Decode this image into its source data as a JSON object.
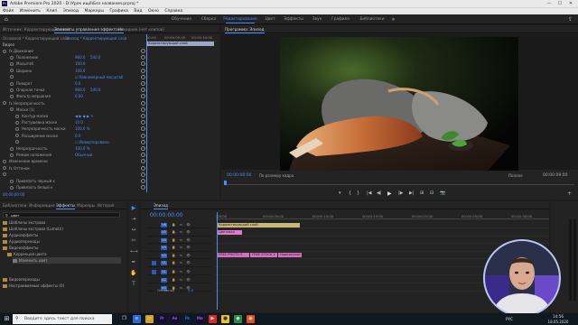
{
  "window": {
    "title": "Adobe Premiere Pro 2020 - D:\\Урок ищё\\Без названия.prproj *",
    "logo": "Pr",
    "min": "—",
    "max": "☐",
    "close": "✕"
  },
  "menu": [
    "Файл",
    "Изменить",
    "Клип",
    "Эпизод",
    "Маркеры",
    "Графика",
    "Вид",
    "Окно",
    "Справка"
  ],
  "workspaces": [
    "Обучение",
    "Сборка",
    "Редактирование",
    "Цвет",
    "Эффекты",
    "Звук",
    "Графика",
    "Библиотеки"
  ],
  "workspace_active": "Редактирование",
  "top_icons": {
    "home": "⌂",
    "more": "»",
    "export": "⇪"
  },
  "effect_controls": {
    "tabs": [
      {
        "label": "Источник: Корректирующий слой",
        "active": false
      },
      {
        "label": "Элементы управления эффектами",
        "active": true
      },
      {
        "label": "Исходник (нет клипов)",
        "active": false
      }
    ],
    "header_source": "Основной * Корректирующий слой",
    "header_seq": "Эпизод * Корректирующий слой",
    "clip_label": "Корректирующий слой",
    "timecodes": [
      "00:00",
      "00:00:05:00",
      "00:00:10:00"
    ],
    "section_video": "Видео",
    "rows": [
      {
        "label": "fx Движение",
        "v1": "",
        "v2": ""
      },
      {
        "label": "Положение",
        "v1": "960.0",
        "v2": "540.0"
      },
      {
        "label": "Масштаб",
        "v1": "100.0",
        "v2": ""
      },
      {
        "label": "Ширина",
        "v1": "100.0",
        "v2": ""
      },
      {
        "label": "",
        "v1": "☑ Равномерный масштаб",
        "v2": ""
      },
      {
        "label": "Поворот",
        "v1": "0.0",
        "v2": ""
      },
      {
        "label": "Опорная точка",
        "v1": "960.0",
        "v2": "540.0"
      },
      {
        "label": "Фильтр мерцания",
        "v1": "0.00",
        "v2": ""
      },
      {
        "label": "fx Непрозрачность",
        "v1": "",
        "v2": ""
      },
      {
        "label": "Маски (1)",
        "v1": "",
        "v2": ""
      },
      {
        "label": "Контур маски",
        "v1": "◀ ▶ ◆ ▶ ✎",
        "v2": ""
      },
      {
        "label": "Растушевка маски",
        "v1": "10.0",
        "v2": ""
      },
      {
        "label": "Непрозрачность маски",
        "v1": "100.0 %",
        "v2": ""
      },
      {
        "label": "Расширение маски",
        "v1": "0.0",
        "v2": ""
      },
      {
        "label": "",
        "v1": "☐ Инвертировано",
        "v2": ""
      },
      {
        "label": "Непрозрачность",
        "v1": "100.0 %",
        "v2": ""
      },
      {
        "label": "Режим наложения",
        "v1": "Обычный",
        "v2": ""
      },
      {
        "label": "Изменение времени",
        "v1": "",
        "v2": ""
      },
      {
        "label": "fx Оттенок",
        "v1": "",
        "v2": ""
      },
      {
        "label": "",
        "v1": "",
        "v2": ""
      },
      {
        "label": "Привязать черный к",
        "v1": "",
        "v2": ""
      },
      {
        "label": "Привязать белый к",
        "v1": "",
        "v2": ""
      }
    ],
    "footer_time": "00:00:00:00"
  },
  "program": {
    "tab": "Программа: Эпизод",
    "timecode": "00:00:00:00",
    "fit": "По размеру кадра",
    "quality": "Полное",
    "duration": "00:00:09:00",
    "transport": [
      "▾",
      "{",
      "}",
      "|◀",
      "◀|",
      "▶",
      "|▶",
      "▶|",
      "⊞",
      "⊟",
      "📷",
      "+"
    ]
  },
  "project": {
    "tabs": [
      {
        "label": "Библиотеки",
        "active": false
      },
      {
        "label": "Информация",
        "active": false
      },
      {
        "label": "Эффекты",
        "active": true
      },
      {
        "label": "Маркеры",
        "active": false
      },
      {
        "label": "История",
        "active": false
      }
    ],
    "search_value": "цвет",
    "items": [
      "Шаблоны экстрава",
      "Шаблоны экстрава (Lumetri)",
      "Аудиоэффекты",
      "Аудиопереходы",
      "Видеоэффекты",
      "Коррекция цвета",
      "Изменить цвет",
      "Видеопереходы",
      "Настраиваемые эффекты (0)"
    ]
  },
  "timeline": {
    "tab": "Эпизод",
    "timecode": "00:00:00:00",
    "ruler": [
      ":00:00",
      "00:00:05:00",
      "00:00:10:00",
      "00:00:15:00",
      "00:00:20:00",
      "00:00:25:00",
      "00:00:30:00"
    ],
    "tracks": [
      {
        "name": "V6",
        "label": "",
        "sel": false
      },
      {
        "name": "V5",
        "label": "",
        "sel": false
      },
      {
        "name": "V4",
        "label": "",
        "sel": false
      },
      {
        "name": "V3",
        "label": "",
        "sel": false
      },
      {
        "name": "V2",
        "label": "",
        "sel": false
      },
      {
        "name": "V1",
        "label": "",
        "sel": true
      },
      {
        "name": "A1",
        "label": "",
        "sel": true
      },
      {
        "name": "A2",
        "label": "",
        "sel": false
      },
      {
        "name": "A3",
        "label": "",
        "sel": false
      }
    ],
    "master": "Основной",
    "master_val": "0.0",
    "clips": {
      "adjust": "Корректирующий слой",
      "pink": "Цветовая",
      "c1": "FREE PHOTO 9",
      "c2": "FREE STOCK 2",
      "c3": "Нарезанное мясо"
    },
    "tools": [
      "▶",
      "⇥",
      "↔",
      "✂",
      "⟷",
      "✒",
      "✋",
      "T"
    ]
  },
  "taskbar": {
    "search": "Введите здесь текст для поиска",
    "time": "14:56",
    "date": "18.05.2020",
    "lang": "РУС"
  },
  "colors": {
    "accent": "#4d8cf7",
    "adjust_clip": "#c9b77a",
    "pink_clip": "#e07cd0",
    "video_clip": "#d96ec2",
    "playhead": "#4d8cf7"
  }
}
